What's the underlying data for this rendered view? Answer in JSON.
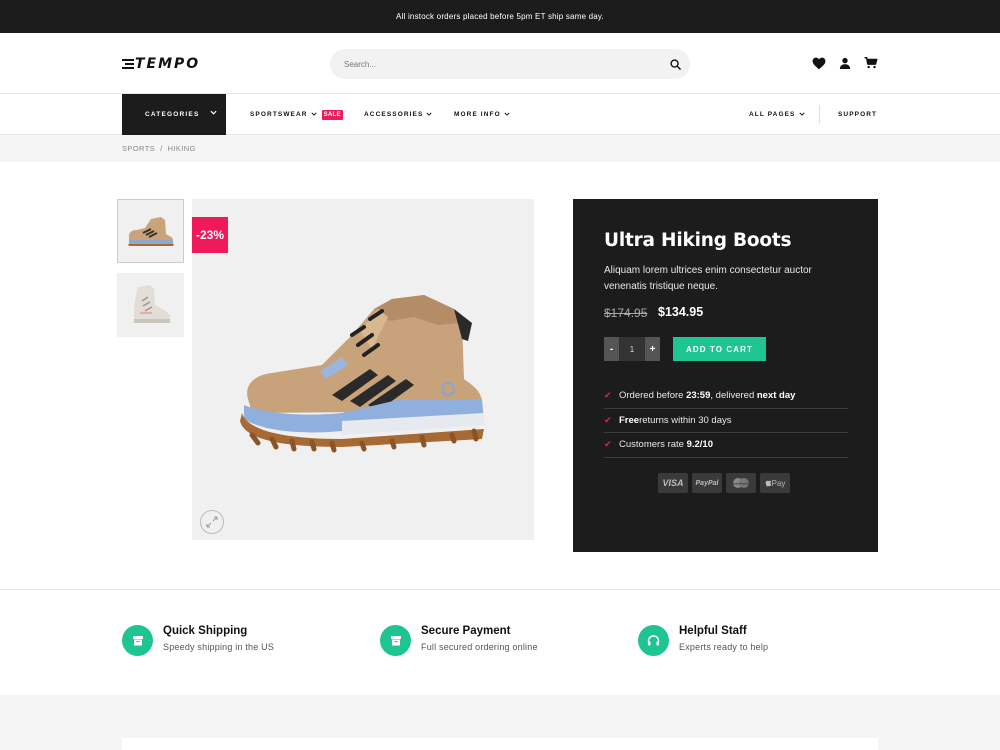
{
  "topbar": {
    "message": "All instock orders placed before 5pm ET ship same day."
  },
  "header": {
    "logo": "TEMPO",
    "search_placeholder": "Search...",
    "icons": [
      "heart-icon",
      "user-icon",
      "cart-icon"
    ]
  },
  "nav": {
    "categories": "CATEGORIES",
    "items": [
      {
        "label": "SPORTSWEAR",
        "badge": "SALE"
      },
      {
        "label": "ACCESSORIES"
      },
      {
        "label": "MORE INFO"
      }
    ],
    "right": [
      {
        "label": "ALL PAGES"
      },
      {
        "label": "SUPPORT"
      }
    ]
  },
  "breadcrumb": {
    "items": [
      "SPORTS",
      "HIKING"
    ],
    "separator": "/"
  },
  "gallery": {
    "discount": "-23%"
  },
  "product": {
    "title": "Ultra Hiking Boots",
    "description": "Aliquam lorem ultrices enim consectetur auctor venenatis tristique neque.",
    "old_price": "$174.95",
    "price": "$134.95",
    "quantity": "1",
    "minus": "-",
    "plus": "+",
    "add_to_cart": "ADD TO CART",
    "benefits": [
      {
        "pre": "Ordered before ",
        "bold": "23:59",
        "mid": ", delivered ",
        "bold2": "next day",
        "post": ""
      },
      {
        "pre": "",
        "bold": "Free",
        "mid": " returns within 30 days",
        "bold2": "",
        "post": ""
      },
      {
        "pre": "Customers rate ",
        "bold": "9.2/10",
        "mid": "",
        "bold2": "",
        "post": ""
      }
    ],
    "payments": [
      "VISA",
      "PayPal",
      "mastercard",
      "Pay"
    ]
  },
  "features": [
    {
      "title": "Quick Shipping",
      "subtitle": "Speedy shipping in the US",
      "icon": "box-icon"
    },
    {
      "title": "Secure Payment",
      "subtitle": "Full secured ordering online",
      "icon": "archive-icon"
    },
    {
      "title": "Helpful Staff",
      "subtitle": "Experts ready to help",
      "icon": "headset-icon"
    }
  ],
  "colors": {
    "accent": "#1fc591",
    "sale": "#f0195a",
    "dark": "#1c1c1c"
  }
}
